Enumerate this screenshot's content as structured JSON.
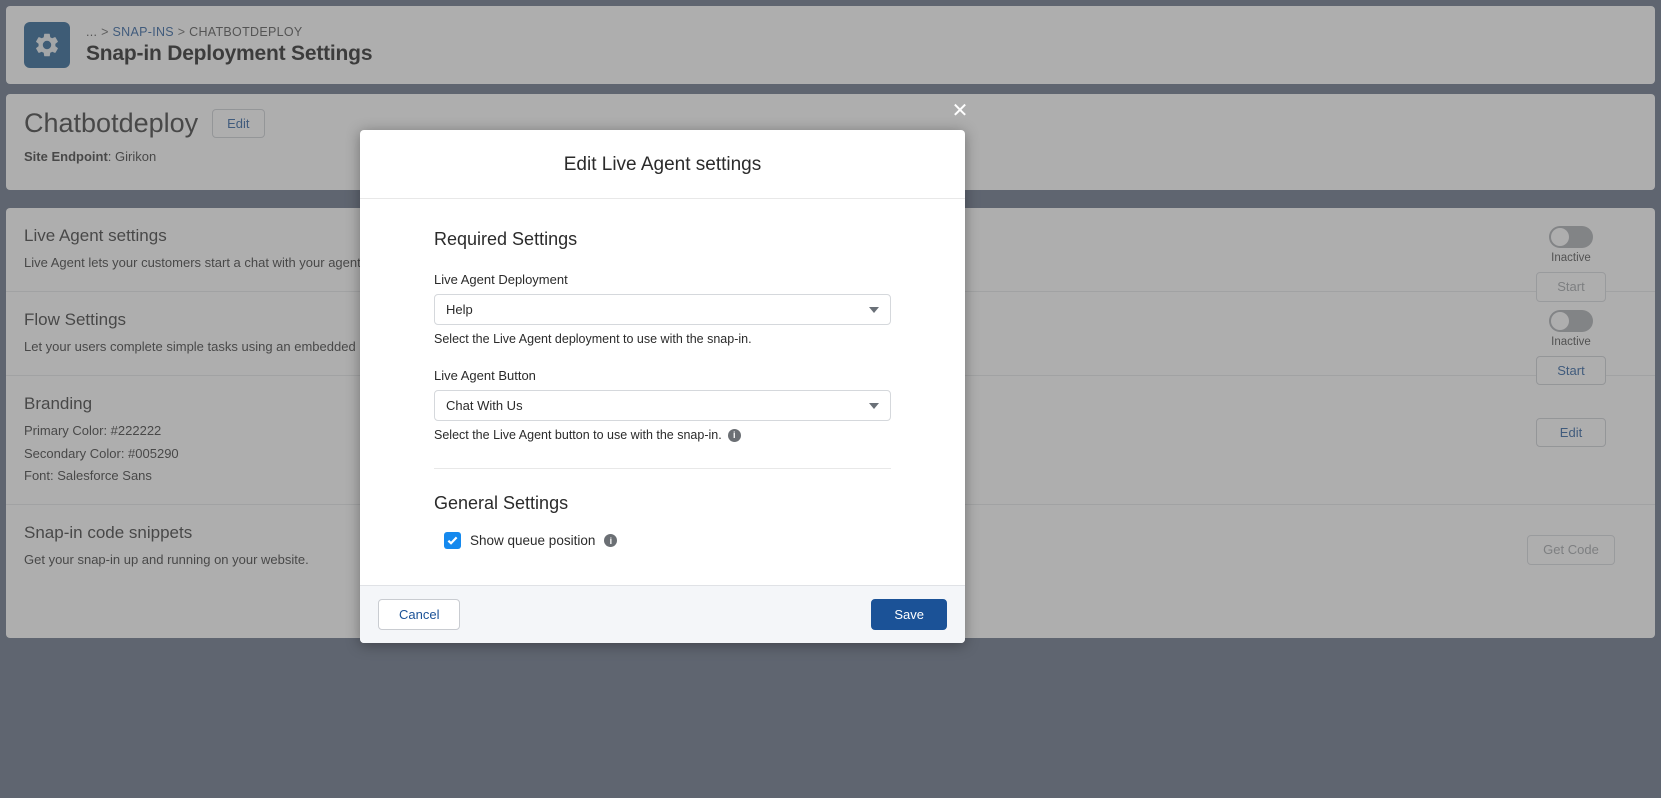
{
  "header": {
    "icon": "gear-icon",
    "breadcrumb": {
      "ellipsis": "...",
      "sep1": ">",
      "link": "SNAP-INS",
      "sep2": ">",
      "current": "CHATBOTDEPLOY"
    },
    "title": "Snap-in Deployment Settings"
  },
  "summary": {
    "name": "Chatbotdeploy",
    "edit_label": "Edit",
    "endpoint_label": "Site Endpoint",
    "endpoint_value": "Girikon",
    "bubble_icon": "chat-bubble-icon"
  },
  "rows": [
    {
      "title": "Live Agent settings",
      "desc": "Live Agent lets your customers start a chat with your agents using",
      "toggle_state": "off",
      "toggle_label": "Inactive",
      "action_label": "Start",
      "action_disabled": true
    },
    {
      "title": "Flow Settings",
      "desc": "Let your users complete simple tasks using an embedded Lightning",
      "toggle_state": "off",
      "toggle_label": "Inactive",
      "action_label": "Start",
      "action_disabled": false
    },
    {
      "title": "Branding",
      "primary_color_line": "Primary Color: #222222",
      "secondary_color_line": "Secondary Color: #005290",
      "font_line": "Font: Salesforce Sans",
      "action_label": "Edit",
      "action_disabled": false
    },
    {
      "title": "Snap-in code snippets",
      "desc": "Get your snap-in up and running on your website.",
      "action_label": "Get Code",
      "action_disabled": true
    }
  ],
  "modal": {
    "close_icon": "close-icon",
    "title": "Edit Live Agent settings",
    "required_section": "Required Settings",
    "deployment": {
      "label": "Live Agent Deployment",
      "value": "Help",
      "hint": "Select the Live Agent deployment to use with the snap-in.",
      "caret_icon": "chevron-down-icon"
    },
    "button": {
      "label": "Live Agent Button",
      "value": "Chat With Us",
      "hint": "Select the Live Agent button to use with the snap-in.",
      "info_icon": "info-icon",
      "caret_icon": "chevron-down-icon"
    },
    "general_section": "General Settings",
    "queue": {
      "label": "Show queue position",
      "checked": true,
      "info_icon": "info-icon"
    },
    "cancel_label": "Cancel",
    "save_label": "Save"
  },
  "colors": {
    "page_bg": "#5a677d",
    "brand_blue": "#1b5297",
    "link_blue": "#1b5297",
    "checkbox_blue": "#1589ee",
    "header_icon_bg": "#16548a"
  }
}
